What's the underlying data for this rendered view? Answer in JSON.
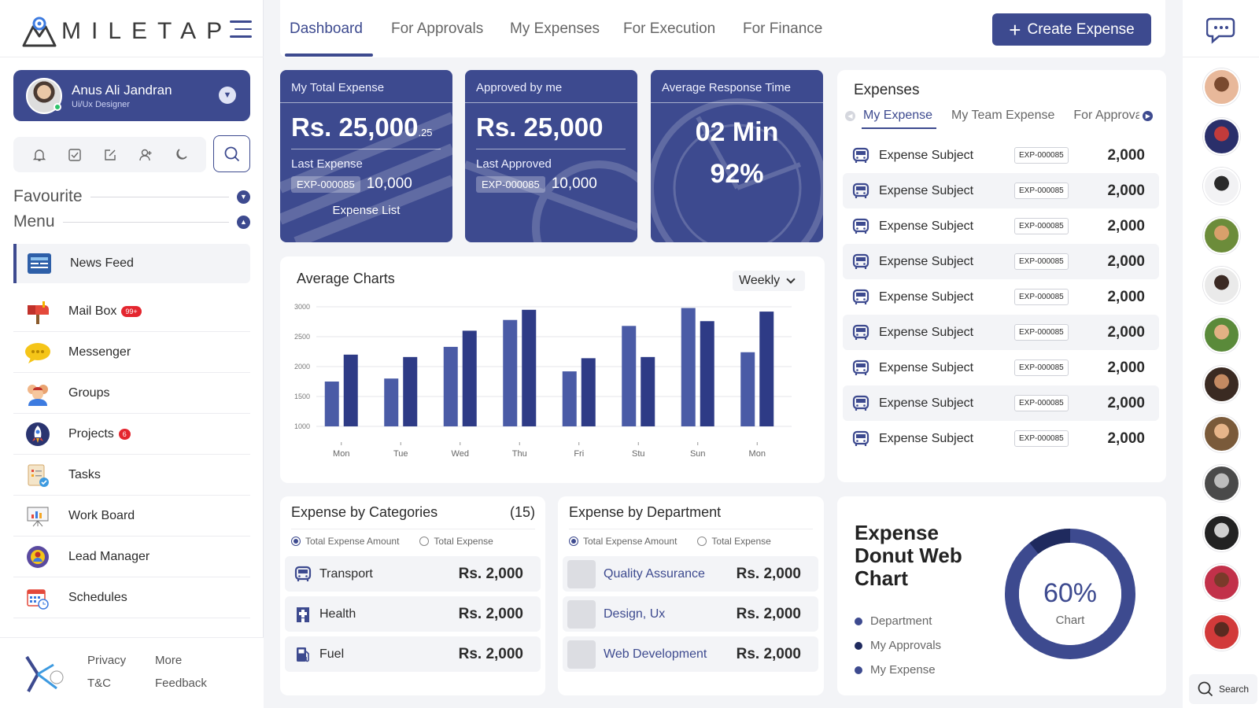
{
  "brand": {
    "name": "MILETAP"
  },
  "user": {
    "name": "Anus Ali Jandran",
    "role": "Ui/Ux Designer"
  },
  "sections": {
    "favourite": "Favourite",
    "menu": "Menu"
  },
  "menu": [
    {
      "label": "News Feed",
      "icon": "news-feed-icon"
    },
    {
      "label": "Mail Box",
      "icon": "mailbox-icon",
      "badge": "99+"
    },
    {
      "label": "Messenger",
      "icon": "messenger-icon"
    },
    {
      "label": "Groups",
      "icon": "groups-icon"
    },
    {
      "label": "Projects",
      "icon": "projects-icon",
      "badge": "6"
    },
    {
      "label": "Tasks",
      "icon": "tasks-icon"
    },
    {
      "label": "Work Board",
      "icon": "work-board-icon"
    },
    {
      "label": "Lead Manager",
      "icon": "lead-manager-icon"
    },
    {
      "label": "Schedules",
      "icon": "schedules-icon"
    }
  ],
  "footer": {
    "privacy": "Privacy",
    "more": "More",
    "tc": "T&C",
    "feedback": "Feedback"
  },
  "tabs": [
    "Dashboard",
    "For Approvals",
    "My Expenses",
    "For Execution",
    "For Finance"
  ],
  "create_button": "Create Expense",
  "stats": {
    "total": {
      "title": "My Total Expense",
      "value": "Rs. 25,000",
      "decimal": ".25",
      "last_label": "Last Expense",
      "code": "EXP-000085",
      "amount": "10,000",
      "link": "Expense List"
    },
    "approved": {
      "title": "Approved by me",
      "value": "Rs. 25,000",
      "last_label": "Last Approved",
      "code": "EXP-000085",
      "amount": "10,000"
    },
    "response": {
      "title": "Average Response Time",
      "time": "02 Min",
      "percent": "92%"
    }
  },
  "average_chart": {
    "title": "Average Charts",
    "period": "Weekly"
  },
  "chart_data": {
    "type": "bar",
    "categories": [
      "Mon",
      "Tue",
      "Wed",
      "Thu",
      "Fri",
      "Stu",
      "Sun",
      "Mon"
    ],
    "series": [
      {
        "values": [
          1750,
          1800,
          2330,
          2780,
          1920,
          2680,
          2980,
          2240
        ],
        "color": "#4a5ba6"
      },
      {
        "values": [
          2200,
          2160,
          2600,
          2950,
          2140,
          2160,
          2760,
          2920
        ],
        "color": "#2e3b86"
      }
    ],
    "yticks": [
      3000,
      2500,
      2000,
      1500,
      1000
    ],
    "ylim": [
      1000,
      3000
    ],
    "grid": true
  },
  "expenses": {
    "title": "Expenses",
    "tabs": [
      "My Expense",
      "My Team Expense",
      "For Approvals"
    ],
    "rows": [
      {
        "subject": "Expense Subject",
        "code": "EXP-000085",
        "value": "2,000"
      },
      {
        "subject": "Expense Subject",
        "code": "EXP-000085",
        "value": "2,000"
      },
      {
        "subject": "Expense Subject",
        "code": "EXP-000085",
        "value": "2,000"
      },
      {
        "subject": "Expense Subject",
        "code": "EXP-000085",
        "value": "2,000"
      },
      {
        "subject": "Expense Subject",
        "code": "EXP-000085",
        "value": "2,000"
      },
      {
        "subject": "Expense Subject",
        "code": "EXP-000085",
        "value": "2,000"
      },
      {
        "subject": "Expense Subject",
        "code": "EXP-000085",
        "value": "2,000"
      },
      {
        "subject": "Expense Subject",
        "code": "EXP-000085",
        "value": "2,000"
      },
      {
        "subject": "Expense Subject",
        "code": "EXP-000085",
        "value": "2,000"
      }
    ]
  },
  "categories": {
    "title": "Expense by Categories",
    "count": "(15)",
    "radio1": "Total Expense Amount",
    "radio2": "Total Expense",
    "rows": [
      {
        "name": "Transport",
        "value": "Rs. 2,000",
        "icon": "bus-icon"
      },
      {
        "name": "Health",
        "value": "Rs. 2,000",
        "icon": "hospital-icon"
      },
      {
        "name": "Fuel",
        "value": "Rs. 2,000",
        "icon": "fuel-icon"
      }
    ]
  },
  "department": {
    "title": "Expense by Department",
    "radio1": "Total Expense Amount",
    "radio2": "Total Expense",
    "rows": [
      {
        "name": "Quality Assurance",
        "value": "Rs. 2,000"
      },
      {
        "name": "Design, Ux",
        "value": "Rs. 2,000"
      },
      {
        "name": "Web Development",
        "value": "Rs. 2,000"
      }
    ]
  },
  "donut": {
    "title": "Expense Donut Web Chart",
    "percent": "60%",
    "label": "Chart",
    "legend": [
      "Department",
      "My Approvals",
      "My Expense"
    ],
    "legend_colors": [
      "#3d4a8f",
      "#1f2a5e",
      "#3d4a8f"
    ]
  },
  "rail": {
    "search": "Search"
  },
  "colors": {
    "primary": "#3d4a8f",
    "dark": "#2e3b86",
    "badge": "#e4262f"
  }
}
